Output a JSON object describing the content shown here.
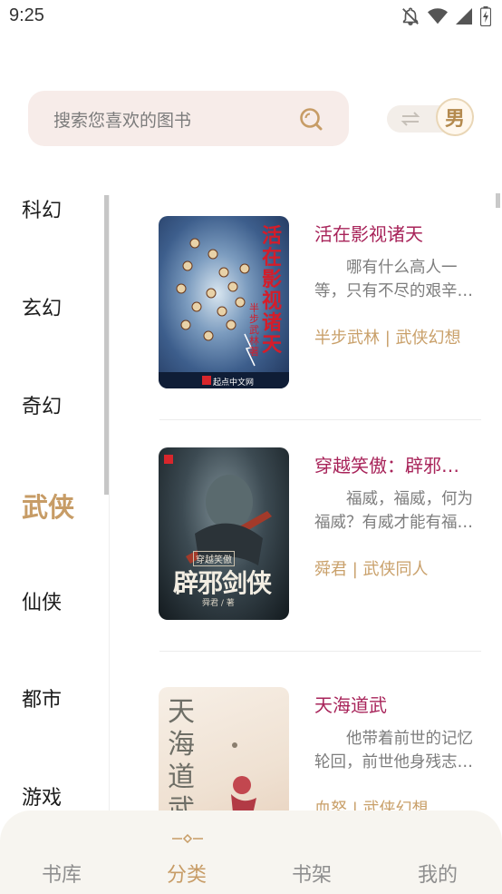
{
  "status_bar": {
    "time": "9:25",
    "icons": [
      "notifications-off-icon",
      "wifi-icon",
      "signal-icon",
      "battery-icon"
    ]
  },
  "search": {
    "placeholder": "搜索您喜欢的图书",
    "icon": "search-icon"
  },
  "gender": {
    "label": "男",
    "swap_icon": "swap-icon"
  },
  "categories": [
    {
      "label": "科幻",
      "active": false
    },
    {
      "label": "玄幻",
      "active": false
    },
    {
      "label": "奇幻",
      "active": false
    },
    {
      "label": "武侠",
      "active": true
    },
    {
      "label": "仙侠",
      "active": false
    },
    {
      "label": "都市",
      "active": false
    },
    {
      "label": "游戏",
      "active": false
    }
  ],
  "books": [
    {
      "title": "活在影视诸天",
      "description": "哪有什么高人一等，只有不尽的艰辛…",
      "meta": "半步武林 | 武侠幻想",
      "cover_text": "活在影视诸天",
      "cover_author": "半步武林 著",
      "cover_brand": "起点中文网"
    },
    {
      "title": "穿越笑傲：辟邪…",
      "description": "福威，福威，何为福威？有威才能有福…",
      "meta": "舜君 | 武侠同人",
      "cover_text": "辟邪剑侠",
      "cover_subtitle": "穿越笑傲",
      "cover_author": "舜君 / 著",
      "cover_brand": "起点中文网"
    },
    {
      "title": "天海道武",
      "description": "他带着前世的记忆轮回，前世他身残志…",
      "meta": "血怒 | 武侠幻想",
      "cover_text": "天海道武"
    }
  ],
  "bottom_nav": [
    {
      "label": "书库",
      "active": false
    },
    {
      "label": "分类",
      "active": true
    },
    {
      "label": "书架",
      "active": false
    },
    {
      "label": "我的",
      "active": false
    }
  ],
  "colors": {
    "accent": "#c79c66",
    "title": "#a8245a",
    "search_bg": "#f7ece9"
  }
}
